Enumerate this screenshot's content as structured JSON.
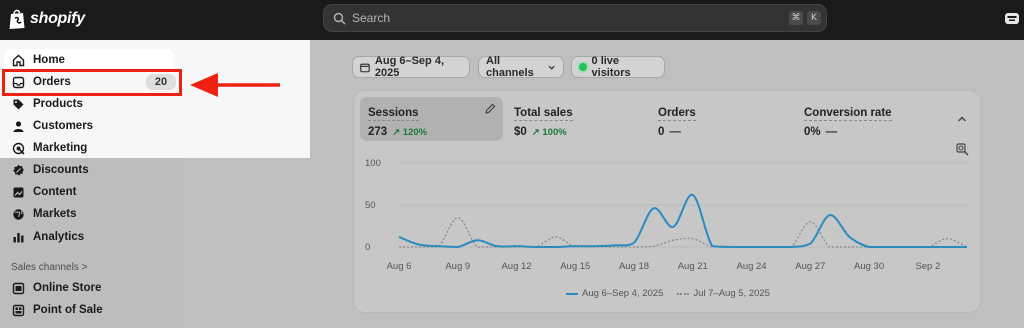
{
  "topbar": {
    "brand": "shopify",
    "search_placeholder": "Search",
    "shortcut": [
      "⌘",
      "K"
    ]
  },
  "sidebar": {
    "items": [
      {
        "label": "Home",
        "icon": "home-icon"
      },
      {
        "label": "Orders",
        "icon": "inbox-icon",
        "badge": "20"
      },
      {
        "label": "Products",
        "icon": "tag-icon"
      },
      {
        "label": "Customers",
        "icon": "person-icon"
      },
      {
        "label": "Marketing",
        "icon": "target-icon"
      },
      {
        "label": "Discounts",
        "icon": "discount-icon"
      },
      {
        "label": "Content",
        "icon": "content-icon"
      },
      {
        "label": "Markets",
        "icon": "globe-icon"
      },
      {
        "label": "Analytics",
        "icon": "bar-chart-icon"
      }
    ],
    "section_label": "Sales channels >",
    "channels": [
      {
        "label": "Online Store",
        "icon": "store-icon"
      },
      {
        "label": "Point of Sale",
        "icon": "pos-icon"
      }
    ]
  },
  "filters": {
    "date_range": "Aug 6–Sep 4, 2025",
    "channels": "All channels",
    "visitors": "0 live visitors"
  },
  "metrics": [
    {
      "label": "Sessions",
      "value": "273",
      "change": "↗ 120%"
    },
    {
      "label": "Total sales",
      "value": "$0",
      "change": "↗ 100%"
    },
    {
      "label": "Orders",
      "value": "0",
      "change": "—"
    },
    {
      "label": "Conversion rate",
      "value": "0%",
      "change": "—"
    }
  ],
  "colors": {
    "current_series": "#2a8bbf",
    "previous_series": "#8a8a8a",
    "highlight": "#ef2212"
  },
  "chart_data": {
    "type": "line",
    "x": [
      "Aug 6",
      "Aug 7",
      "Aug 8",
      "Aug 9",
      "Aug 10",
      "Aug 11",
      "Aug 12",
      "Aug 13",
      "Aug 14",
      "Aug 15",
      "Aug 16",
      "Aug 17",
      "Aug 18",
      "Aug 19",
      "Aug 20",
      "Aug 21",
      "Aug 22",
      "Aug 23",
      "Aug 24",
      "Aug 25",
      "Aug 26",
      "Aug 27",
      "Aug 28",
      "Aug 29",
      "Aug 30",
      "Aug 31",
      "Sep 1",
      "Sep 2",
      "Sep 3",
      "Sep 4"
    ],
    "xticks": [
      "Aug 6",
      "Aug 9",
      "Aug 12",
      "Aug 15",
      "Aug 18",
      "Aug 21",
      "Aug 24",
      "Aug 27",
      "Aug 30",
      "Sep 2"
    ],
    "yticks": [
      0,
      50,
      100
    ],
    "ylim": [
      0,
      100
    ],
    "series": [
      {
        "name": "Aug 6–Sep 4, 2025",
        "values": [
          12,
          3,
          1,
          0,
          8,
          1,
          1,
          0,
          0,
          1,
          1,
          2,
          5,
          46,
          24,
          62,
          1,
          0,
          0,
          0,
          0,
          4,
          38,
          12,
          0,
          0,
          0,
          0,
          0,
          0
        ]
      },
      {
        "name": "Jul 7–Aug 5, 2025",
        "values": [
          0,
          0,
          0,
          35,
          0,
          0,
          0,
          0,
          12,
          0,
          0,
          0,
          0,
          1,
          8,
          10,
          0,
          0,
          0,
          0,
          0,
          30,
          0,
          0,
          0,
          0,
          0,
          0,
          10,
          0
        ]
      }
    ]
  }
}
